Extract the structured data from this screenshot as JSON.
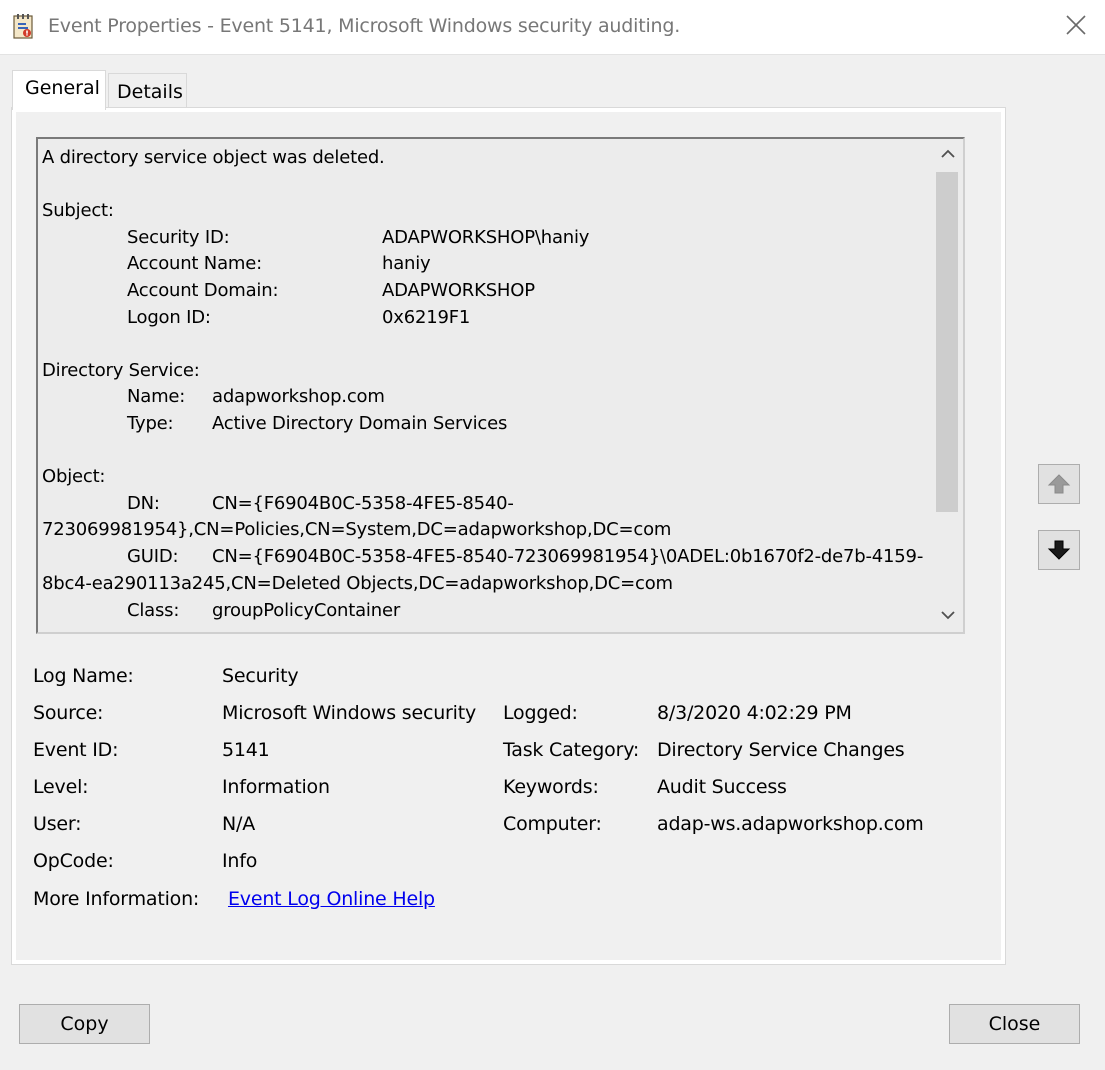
{
  "window": {
    "title": "Event Properties - Event 5141, Microsoft Windows security auditing.",
    "icon": "event-viewer-icon",
    "close_icon": "close-icon"
  },
  "tabs": [
    {
      "label": "General",
      "selected": true
    },
    {
      "label": "Details",
      "selected": false
    }
  ],
  "message": {
    "lines": [
      "A directory service object was deleted.",
      "",
      "Subject:",
      "Security ID:",
      "Account Name:",
      "Account Domain:",
      "Logon ID:",
      "",
      "Directory Service:",
      "Name:",
      "Type:",
      "",
      "Object:",
      "DN:",
      "723069981954},CN=Policies,CN=System,DC=adapworkshop,DC=com",
      "GUID:",
      "8bc4-ea290113a245,CN=Deleted Objects,DC=adapworkshop,DC=com",
      "Class:"
    ],
    "subject": {
      "security_id": "ADAPWORKSHOP\\haniy",
      "account_name": "haniy",
      "account_domain": "ADAPWORKSHOP",
      "logon_id": "0x6219F1"
    },
    "directory_service": {
      "name": "adapworkshop.com",
      "type": "Active Directory Domain Services"
    },
    "object": {
      "dn_first": "CN={F6904B0C-5358-4FE5-8540-",
      "guid_first": "CN={F6904B0C-5358-4FE5-8540-723069981954}\\0ADEL:0b1670f2-de7b-4159-",
      "class": "groupPolicyContainer"
    }
  },
  "fields": {
    "log_name": {
      "label": "Log Name:",
      "value": "Security"
    },
    "source": {
      "label": "Source:",
      "value": "Microsoft Windows security"
    },
    "logged": {
      "label": "Logged:",
      "value": "8/3/2020 4:02:29 PM"
    },
    "event_id": {
      "label": "Event ID:",
      "value": "5141"
    },
    "task_category": {
      "label": "Task Category:",
      "value": "Directory Service Changes"
    },
    "level": {
      "label": "Level:",
      "value": "Information"
    },
    "keywords": {
      "label": "Keywords:",
      "value": "Audit Success"
    },
    "user": {
      "label": "User:",
      "value": "N/A"
    },
    "computer": {
      "label": "Computer:",
      "value": "adap-ws.adapworkshop.com"
    },
    "opcode": {
      "label": "OpCode:",
      "value": "Info"
    },
    "more_info": {
      "label": "More Information:",
      "value": "Event Log Online Help"
    }
  },
  "nav": {
    "up_icon": "arrow-up-icon",
    "down_icon": "arrow-down-icon"
  },
  "buttons": {
    "copy": "Copy",
    "close": "Close"
  },
  "colors": {
    "link": "#0000ee",
    "dialog_bg": "#f0f0f0",
    "button_bg": "#e1e1e1"
  }
}
